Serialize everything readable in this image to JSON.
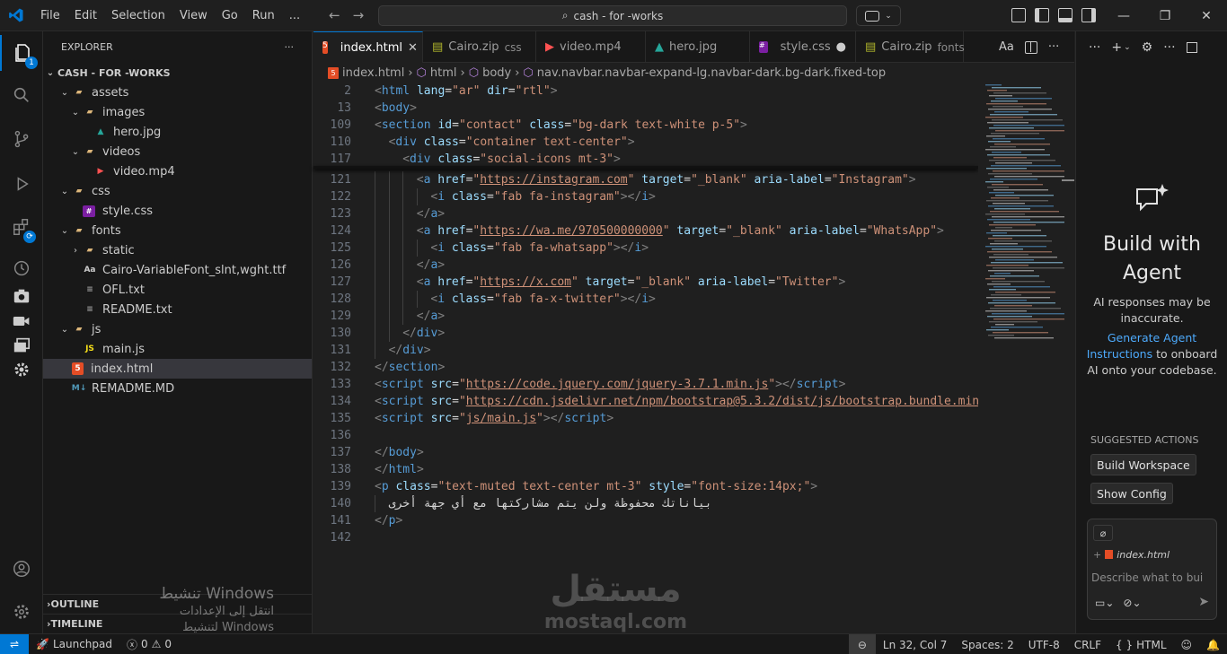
{
  "menu": [
    "File",
    "Edit",
    "Selection",
    "View",
    "Go",
    "Run",
    "..."
  ],
  "search": {
    "text": "cash - for -works"
  },
  "window_controls": [
    "—",
    "❐",
    "✕"
  ],
  "activity": {
    "badge": "1"
  },
  "explorer": {
    "title": "EXPLORER",
    "more": "···",
    "root": "CASH - FOR -WORKS",
    "items": [
      {
        "label": "assets",
        "depth": 1,
        "type": "folder",
        "open": true
      },
      {
        "label": "images",
        "depth": 2,
        "type": "folder",
        "open": true
      },
      {
        "label": "hero.jpg",
        "depth": 3,
        "type": "image"
      },
      {
        "label": "videos",
        "depth": 2,
        "type": "folder",
        "open": true
      },
      {
        "label": "video.mp4",
        "depth": 3,
        "type": "video"
      },
      {
        "label": "css",
        "depth": 1,
        "type": "folder",
        "open": true
      },
      {
        "label": "style.css",
        "depth": 2,
        "type": "css"
      },
      {
        "label": "fonts",
        "depth": 1,
        "type": "folder",
        "open": true
      },
      {
        "label": "static",
        "depth": 2,
        "type": "folder",
        "open": false
      },
      {
        "label": "Cairo-VariableFont_slnt,wght.ttf",
        "depth": 2,
        "type": "font"
      },
      {
        "label": "OFL.txt",
        "depth": 2,
        "type": "text"
      },
      {
        "label": "README.txt",
        "depth": 2,
        "type": "text"
      },
      {
        "label": "js",
        "depth": 1,
        "type": "folder",
        "open": true
      },
      {
        "label": "main.js",
        "depth": 2,
        "type": "js"
      },
      {
        "label": "index.html",
        "depth": 1,
        "type": "html",
        "selected": true
      },
      {
        "label": "REMADME.MD",
        "depth": 1,
        "type": "md"
      }
    ],
    "outline": "OUTLINE",
    "timeline": "TIMELINE"
  },
  "tabs": [
    {
      "label": "index.html",
      "desc": "",
      "type": "html",
      "active": true,
      "close": "✕"
    },
    {
      "label": "Cairo.zip",
      "desc": "css",
      "type": "zip"
    },
    {
      "label": "video.mp4",
      "desc": "",
      "type": "video"
    },
    {
      "label": "hero.jpg",
      "desc": "",
      "type": "image"
    },
    {
      "label": "style.css",
      "desc": "",
      "type": "css",
      "dirty": "●"
    },
    {
      "label": "Cairo.zip",
      "desc": "fonts",
      "type": "zip"
    }
  ],
  "breadcrumb": [
    "index.html",
    "html",
    "body",
    "nav.navbar.navbar-expand-lg.navbar-dark.bg-dark.fixed-top"
  ],
  "code_lines": [
    {
      "n": "2",
      "indent": 0,
      "tokens": [
        [
          "br",
          "<"
        ],
        [
          "tag",
          "html"
        ],
        [
          "txt",
          " "
        ],
        [
          "attr",
          "lang"
        ],
        [
          "txt",
          "="
        ],
        [
          "str",
          "\"ar\""
        ],
        [
          "txt",
          " "
        ],
        [
          "attr",
          "dir"
        ],
        [
          "txt",
          "="
        ],
        [
          "str",
          "\"rtl\""
        ],
        [
          "br",
          ">"
        ]
      ]
    },
    {
      "n": "13",
      "indent": 0,
      "tokens": [
        [
          "br",
          "<"
        ],
        [
          "tag",
          "body"
        ],
        [
          "br",
          ">"
        ]
      ]
    },
    {
      "n": "109",
      "indent": 0,
      "tokens": [
        [
          "br",
          "<"
        ],
        [
          "tag",
          "section"
        ],
        [
          "txt",
          " "
        ],
        [
          "attr",
          "id"
        ],
        [
          "txt",
          "="
        ],
        [
          "str",
          "\"contact\""
        ],
        [
          "txt",
          " "
        ],
        [
          "attr",
          "class"
        ],
        [
          "txt",
          "="
        ],
        [
          "str",
          "\"bg-dark text-white p-5\""
        ],
        [
          "br",
          ">"
        ]
      ]
    },
    {
      "n": "110",
      "indent": 1,
      "tokens": [
        [
          "br",
          "<"
        ],
        [
          "tag",
          "div"
        ],
        [
          "txt",
          " "
        ],
        [
          "attr",
          "class"
        ],
        [
          "txt",
          "="
        ],
        [
          "str",
          "\"container text-center\""
        ],
        [
          "br",
          ">"
        ]
      ]
    },
    {
      "n": "117",
      "indent": 2,
      "tokens": [
        [
          "br",
          "<"
        ],
        [
          "tag",
          "div"
        ],
        [
          "txt",
          " "
        ],
        [
          "attr",
          "class"
        ],
        [
          "txt",
          "="
        ],
        [
          "str",
          "\"social-icons mt-3\""
        ],
        [
          "br",
          ">"
        ]
      ]
    },
    {
      "n": "121",
      "indent": 3,
      "tokens": [
        [
          "br",
          "<"
        ],
        [
          "tag",
          "a"
        ],
        [
          "txt",
          " "
        ],
        [
          "attr",
          "href"
        ],
        [
          "txt",
          "="
        ],
        [
          "str",
          "\""
        ],
        [
          "url",
          "https://instagram.com"
        ],
        [
          "str",
          "\""
        ],
        [
          "txt",
          " "
        ],
        [
          "attr",
          "target"
        ],
        [
          "txt",
          "="
        ],
        [
          "str",
          "\"_blank\""
        ],
        [
          "txt",
          " "
        ],
        [
          "attr",
          "aria-label"
        ],
        [
          "txt",
          "="
        ],
        [
          "str",
          "\"Instagram\""
        ],
        [
          "br",
          ">"
        ]
      ]
    },
    {
      "n": "122",
      "indent": 4,
      "tokens": [
        [
          "br",
          "<"
        ],
        [
          "tag",
          "i"
        ],
        [
          "txt",
          " "
        ],
        [
          "attr",
          "class"
        ],
        [
          "txt",
          "="
        ],
        [
          "str",
          "\"fab fa-instagram\""
        ],
        [
          "br",
          "></"
        ],
        [
          "tag",
          "i"
        ],
        [
          "br",
          ">"
        ]
      ]
    },
    {
      "n": "123",
      "indent": 3,
      "tokens": [
        [
          "br",
          "</"
        ],
        [
          "tag",
          "a"
        ],
        [
          "br",
          ">"
        ]
      ]
    },
    {
      "n": "124",
      "indent": 3,
      "tokens": [
        [
          "br",
          "<"
        ],
        [
          "tag",
          "a"
        ],
        [
          "txt",
          " "
        ],
        [
          "attr",
          "href"
        ],
        [
          "txt",
          "="
        ],
        [
          "str",
          "\""
        ],
        [
          "url",
          "https://wa.me/970500000000"
        ],
        [
          "str",
          "\""
        ],
        [
          "txt",
          " "
        ],
        [
          "attr",
          "target"
        ],
        [
          "txt",
          "="
        ],
        [
          "str",
          "\"_blank\""
        ],
        [
          "txt",
          " "
        ],
        [
          "attr",
          "aria-label"
        ],
        [
          "txt",
          "="
        ],
        [
          "str",
          "\"WhatsApp\""
        ],
        [
          "br",
          ">"
        ]
      ]
    },
    {
      "n": "125",
      "indent": 4,
      "tokens": [
        [
          "br",
          "<"
        ],
        [
          "tag",
          "i"
        ],
        [
          "txt",
          " "
        ],
        [
          "attr",
          "class"
        ],
        [
          "txt",
          "="
        ],
        [
          "str",
          "\"fab fa-whatsapp\""
        ],
        [
          "br",
          "></"
        ],
        [
          "tag",
          "i"
        ],
        [
          "br",
          ">"
        ]
      ]
    },
    {
      "n": "126",
      "indent": 3,
      "tokens": [
        [
          "br",
          "</"
        ],
        [
          "tag",
          "a"
        ],
        [
          "br",
          ">"
        ]
      ]
    },
    {
      "n": "127",
      "indent": 3,
      "tokens": [
        [
          "br",
          "<"
        ],
        [
          "tag",
          "a"
        ],
        [
          "txt",
          " "
        ],
        [
          "attr",
          "href"
        ],
        [
          "txt",
          "="
        ],
        [
          "str",
          "\""
        ],
        [
          "url",
          "https://x.com"
        ],
        [
          "str",
          "\""
        ],
        [
          "txt",
          " "
        ],
        [
          "attr",
          "target"
        ],
        [
          "txt",
          "="
        ],
        [
          "str",
          "\"_blank\""
        ],
        [
          "txt",
          " "
        ],
        [
          "attr",
          "aria-label"
        ],
        [
          "txt",
          "="
        ],
        [
          "str",
          "\"Twitter\""
        ],
        [
          "br",
          ">"
        ]
      ]
    },
    {
      "n": "128",
      "indent": 4,
      "tokens": [
        [
          "br",
          "<"
        ],
        [
          "tag",
          "i"
        ],
        [
          "txt",
          " "
        ],
        [
          "attr",
          "class"
        ],
        [
          "txt",
          "="
        ],
        [
          "str",
          "\"fab fa-x-twitter\""
        ],
        [
          "br",
          "></"
        ],
        [
          "tag",
          "i"
        ],
        [
          "br",
          ">"
        ]
      ]
    },
    {
      "n": "129",
      "indent": 3,
      "tokens": [
        [
          "br",
          "</"
        ],
        [
          "tag",
          "a"
        ],
        [
          "br",
          ">"
        ]
      ]
    },
    {
      "n": "130",
      "indent": 2,
      "tokens": [
        [
          "br",
          "</"
        ],
        [
          "tag",
          "div"
        ],
        [
          "br",
          ">"
        ]
      ]
    },
    {
      "n": "131",
      "indent": 1,
      "tokens": [
        [
          "br",
          "</"
        ],
        [
          "tag",
          "div"
        ],
        [
          "br",
          ">"
        ]
      ]
    },
    {
      "n": "132",
      "indent": 0,
      "tokens": [
        [
          "br",
          "</"
        ],
        [
          "tag",
          "section"
        ],
        [
          "br",
          ">"
        ]
      ]
    },
    {
      "n": "133",
      "indent": 0,
      "tokens": [
        [
          "br",
          "<"
        ],
        [
          "tag",
          "script"
        ],
        [
          "txt",
          " "
        ],
        [
          "attr",
          "src"
        ],
        [
          "txt",
          "="
        ],
        [
          "str",
          "\""
        ],
        [
          "url",
          "https://code.jquery.com/jquery-3.7.1.min.js"
        ],
        [
          "str",
          "\""
        ],
        [
          "br",
          "></"
        ],
        [
          "tag",
          "script"
        ],
        [
          "br",
          ">"
        ]
      ]
    },
    {
      "n": "134",
      "indent": 0,
      "tokens": [
        [
          "br",
          "<"
        ],
        [
          "tag",
          "script"
        ],
        [
          "txt",
          " "
        ],
        [
          "attr",
          "src"
        ],
        [
          "txt",
          "="
        ],
        [
          "str",
          "\""
        ],
        [
          "url",
          "https://cdn.jsdelivr.net/npm/bootstrap@5.3.2/dist/js/bootstrap.bundle.min."
        ]
      ]
    },
    {
      "n": "135",
      "indent": 0,
      "tokens": [
        [
          "br",
          "<"
        ],
        [
          "tag",
          "script"
        ],
        [
          "txt",
          " "
        ],
        [
          "attr",
          "src"
        ],
        [
          "txt",
          "="
        ],
        [
          "str",
          "\""
        ],
        [
          "url",
          "js/main.js"
        ],
        [
          "str",
          "\""
        ],
        [
          "br",
          "></"
        ],
        [
          "tag",
          "script"
        ],
        [
          "br",
          ">"
        ]
      ]
    },
    {
      "n": "136",
      "indent": 0,
      "tokens": []
    },
    {
      "n": "137",
      "indent": 0,
      "tokens": [
        [
          "br",
          "</"
        ],
        [
          "tag",
          "body"
        ],
        [
          "br",
          ">"
        ]
      ]
    },
    {
      "n": "138",
      "indent": 0,
      "tokens": [
        [
          "br",
          "</"
        ],
        [
          "tag",
          "html"
        ],
        [
          "br",
          ">"
        ]
      ]
    },
    {
      "n": "139",
      "indent": 0,
      "tokens": [
        [
          "br",
          "<"
        ],
        [
          "tag",
          "p"
        ],
        [
          "txt",
          " "
        ],
        [
          "attr",
          "class"
        ],
        [
          "txt",
          "="
        ],
        [
          "str",
          "\"text-muted text-center mt-3\""
        ],
        [
          "txt",
          " "
        ],
        [
          "attr",
          "style"
        ],
        [
          "txt",
          "="
        ],
        [
          "str",
          "\"font-size:14px;\""
        ],
        [
          "br",
          ">"
        ]
      ]
    },
    {
      "n": "140",
      "indent": 1,
      "tokens": [
        [
          "txt",
          "بياناتك محفوظة ولن يتم مشاركتها مع أي جهة أخرى"
        ]
      ]
    },
    {
      "n": "141",
      "indent": 0,
      "tokens": [
        [
          "br",
          "</"
        ],
        [
          "tag",
          "p"
        ],
        [
          "br",
          ">"
        ]
      ]
    },
    {
      "n": "142",
      "indent": 0,
      "tokens": []
    }
  ],
  "chat": {
    "title": "Build with Agent",
    "disclaimer": "AI responses may be inaccurate.",
    "instructions_link": "Generate Agent Instructions",
    "instructions_rest": " to onboard AI onto your codebase.",
    "suggested": "SUGGESTED ACTIONS",
    "actions": [
      "Build Workspace",
      "Show Config"
    ],
    "context_file": "index.html",
    "placeholder": "Describe what to build"
  },
  "status": {
    "launchpad": "Launchpad",
    "errors": "0",
    "warnings": "0",
    "position": "Ln 32, Col 7",
    "spaces": "Spaces: 2",
    "encoding": "UTF-8",
    "eol": "CRLF",
    "language": "HTML"
  },
  "watermark": {
    "windows_title": "تنشيط Windows",
    "windows_sub": "انتقل إلى الإعدادات لتنشيط Windows",
    "brand_ar": "مستقل",
    "brand_en": "mostaql.com"
  },
  "colors": {
    "accent": "#0078d4",
    "html_icon": "#e44d26",
    "css_icon": "#42a5f5",
    "js_icon": "#f5de19",
    "folder": "#dcb67a"
  }
}
